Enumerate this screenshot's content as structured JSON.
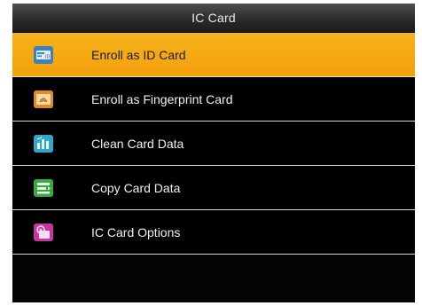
{
  "window": {
    "title": "IC Card"
  },
  "menu": {
    "items": [
      {
        "label": "Enroll as ID Card",
        "icon": "id-card-icon",
        "selected": true,
        "color": "#3f7fc4"
      },
      {
        "label": "Enroll as Fingerprint Card",
        "icon": "fingerprint-card-icon",
        "selected": false,
        "color": "#e08a2a"
      },
      {
        "label": "Clean Card Data",
        "icon": "clean-data-icon",
        "selected": false,
        "color": "#32a8c6"
      },
      {
        "label": "Copy Card Data",
        "icon": "copy-data-icon",
        "selected": false,
        "color": "#3aa844"
      },
      {
        "label": "IC Card Options",
        "icon": "card-options-icon",
        "selected": false,
        "color": "#c4379e"
      }
    ]
  },
  "colors": {
    "highlight": "#f4a712",
    "background": "#050505"
  }
}
